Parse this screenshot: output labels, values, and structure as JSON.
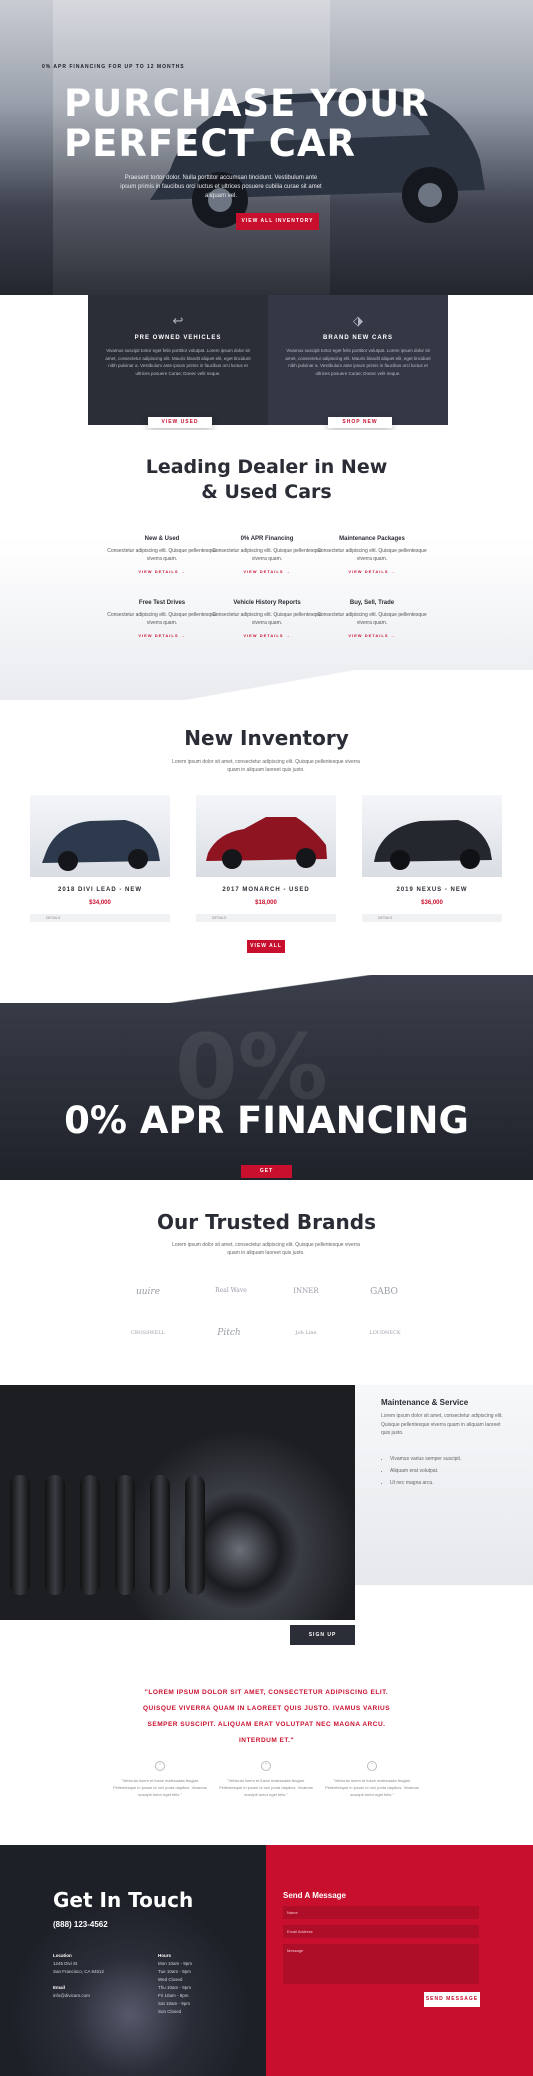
{
  "hero": {
    "kicker": "0% APR FINANCING FOR UP TO 12 MONTHS",
    "title_line1": "PURCHASE YOUR",
    "title_line2": "PERFECT CAR",
    "text": "Praesent tortor dolor. Nulla porttitor accumsan tincidunt. Vestibulum ante ipsum primis in faucibus orci luctus et ultrices posuere cubilia curae sit amet aliquam vel.",
    "button": "VIEW ALL INVENTORY"
  },
  "vehicles": [
    {
      "icon": "return-arrow-icon",
      "title": "PRE OWNED VEHICLES",
      "text": "Vivamus suscipit tortor eget felis porttitor volutpat. Lorem ipsum dolor sit amet, consectetur adipiscing elit. Mauris blandit aliquet elit, eget tincidunt nibh pulvinar a. Vestibulum ante ipsum primis in faucibus orci luctus et ultrices posuere Curae; Donec velit neque.",
      "button": "VIEW USED"
    },
    {
      "icon": "tag-icon",
      "title": "BRAND NEW CARS",
      "text": "Vivamus suscipit tortor eget felis porttitor volutpat. Lorem ipsum dolor sit amet, consectetur adipiscing elit. Mauris blandit aliquet elit, eget tincidunt nibh pulvinar a. Vestibulum ante ipsum primis in faucibus orci luctus et ultrices posuere Curae; Donec velit neque.",
      "button": "SHOP NEW"
    }
  ],
  "dealer": {
    "title_line1": "Leading Dealer in New",
    "title_line2": "& Used Cars",
    "features": [
      {
        "title": "New & Used",
        "text": "Consectetur adipiscing elit. Quisque pellentesque viverra quam.",
        "link": "VIEW DETAILS →"
      },
      {
        "title": "0% APR Financing",
        "text": "Consectetur adipiscing elit. Quisque pellentesque viverra quam.",
        "link": "VIEW DETAILS →"
      },
      {
        "title": "Maintenance Packages",
        "text": "Consectetur adipiscing elit. Quisque pellentesque viverra quam.",
        "link": "VIEW DETAILS →"
      },
      {
        "title": "Free Test Drives",
        "text": "Consectetur adipiscing elit. Quisque pellentesque viverra quam.",
        "link": "VIEW DETAILS →"
      },
      {
        "title": "Vehicle History Reports",
        "text": "Consectetur adipiscing elit. Quisque pellentesque viverra quam.",
        "link": "VIEW DETAILS →"
      },
      {
        "title": "Buy, Sell, Trade",
        "text": "Consectetur adipiscing elit. Quisque pellentesque viverra quam.",
        "link": "VIEW DETAILS →"
      }
    ]
  },
  "inventory": {
    "title": "New Inventory",
    "subtitle": "Lorem ipsum dolor sit amet, consectetur adipiscing elit. Quisque pellentesque viverra quam in aliquam laoreet quis justo.",
    "cars": [
      {
        "name": "2018 DIVI LEAD - NEW",
        "price": "$34,000",
        "details": "DETAILS",
        "color": "#2d3a4d"
      },
      {
        "name": "2017 MONARCH - USED",
        "price": "$18,000",
        "details": "DETAILS",
        "color": "#8e1422"
      },
      {
        "name": "2019 NEXUS - NEW",
        "price": "$36,000",
        "details": "DETAILS",
        "color": "#24272e"
      }
    ],
    "button": "VIEW ALL"
  },
  "finance": {
    "title": "0% APR FINANCING",
    "button": "GET FINANCING"
  },
  "brands": {
    "title": "Our Trusted Brands",
    "subtitle": "Lorem ipsum dolor sit amet, consectetur adipiscing elit. Quisque pellentesque viverra quam in aliquam laoreet quis justo.",
    "logos": [
      "uuire",
      "Real Wave",
      "INNER",
      "GABO",
      "CROSSWELL",
      "Pitch",
      "Job Line",
      "LOUDNECK"
    ]
  },
  "maintenance": {
    "title": "Maintenance & Service",
    "text": "Lorem ipsum dolor sit amet, consectetur adipiscing elit. Quisque pellentesque viverra quam in aliquam laoreet quis justo.",
    "bullets": [
      "Vivamus varius semper suscipit.",
      "Aliquam erat volutpat.",
      "Ut nec magna arcu."
    ],
    "button": "SIGN UP"
  },
  "quote": {
    "text": "\"LOREM IPSUM DOLOR SIT AMET, CONSECTETUR ADIPISCING ELIT. QUISQUE VIVERRA QUAM IN LAOREET QUIS JUSTO. IVAMUS VARIUS SEMPER SUSCIPIT. ALIQUAM ERAT VOLUTPAT NEC MAGNA ARCU. INTERDUM ET.\"",
    "testimonials": [
      {
        "text": "\"Vehicula lorem et fusce malesuada feugiat. Pellentesque in ipsum id orci porta dapibus. Vivamus suscipit tortor eget felis.\""
      },
      {
        "text": "\"Vehicula lorem et fusce malesuada feugiat. Pellentesque in ipsum id orci porta dapibus. Vivamus suscipit tortor eget felis.\""
      },
      {
        "text": "\"Vehicula lorem et fusce malesuada feugiat. Pellentesque in ipsum id orci porta dapibus. Vivamus suscipit tortor eget felis.\""
      }
    ]
  },
  "contact": {
    "title": "Get In Touch",
    "phone": "(888) 123-4562",
    "location_label": "Location",
    "location": "1245 Divi St",
    "city": "San Francisco, CA 94512",
    "email_label": "Email",
    "email": "info@divicars.com",
    "hours_label": "Hours",
    "hours": [
      "Mon 10am - 9pm",
      "Tue 10am - 9pm",
      "Wed Closed",
      "Thu 10am - 9pm",
      "Fri 10am - 9pm",
      "Sat 10am - 9pm",
      "Sun Closed"
    ],
    "form_title": "Send A Message",
    "name_placeholder": "Name",
    "email_placeholder": "Email Address",
    "message_placeholder": "Message",
    "send": "SEND MESSAGE"
  },
  "colors": {
    "accent": "#c8102e",
    "dark": "#2b2e37"
  }
}
